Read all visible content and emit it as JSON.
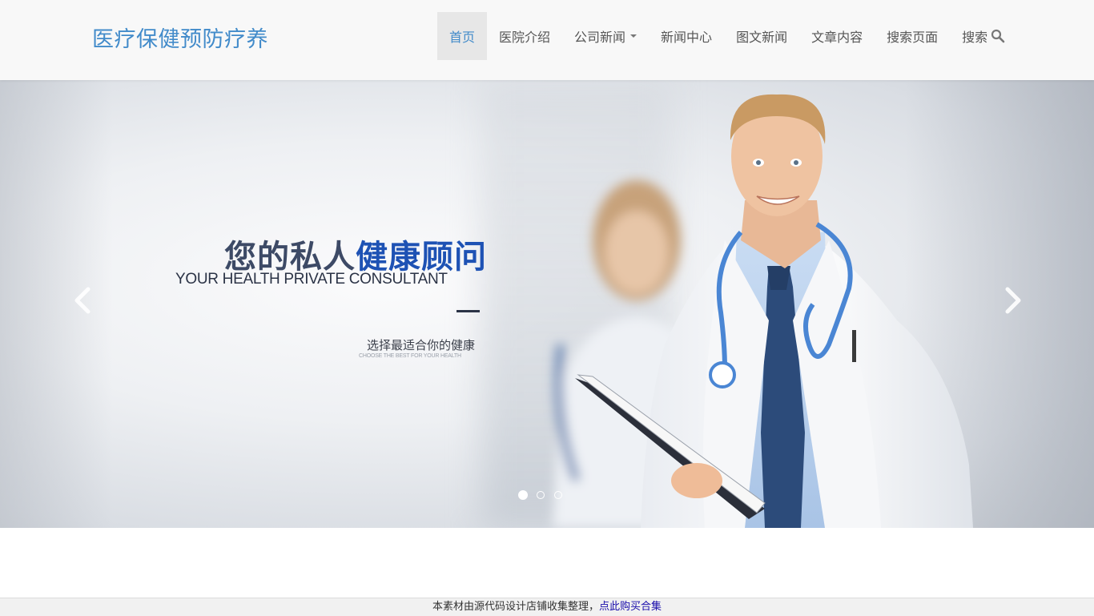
{
  "brand": {
    "title": "医疗保健预防疗养"
  },
  "nav": {
    "home": "首页",
    "hospital": "医院介绍",
    "company_news": "公司新闻",
    "news_center": "新闻中心",
    "photo_news": "图文新闻",
    "articles": "文章内容",
    "search_page": "搜索页面",
    "search": "搜索"
  },
  "carousel": {
    "headline_dark": "您的私人",
    "headline_blue": "健康顾问",
    "subline": "YOUR HEALTH PRIVATE CONSULTANT",
    "tagline": "选择最适合你的健康",
    "tagline_en": "CHOOSE THE BEST FOR YOUR HEALTH",
    "slide_count": 3,
    "active_slide": 1
  },
  "notice": {
    "text": "本素材由源代码设计店铺收集整理，",
    "link": "点此购买合集"
  },
  "colors": {
    "brand": "#428bca",
    "nav_active_bg": "#e7e7e7",
    "headline_blue": "#1e52b4",
    "link": "#1a0dab"
  },
  "icons": [
    "caret-down-icon",
    "search-icon",
    "chevron-left-icon",
    "chevron-right-icon"
  ]
}
